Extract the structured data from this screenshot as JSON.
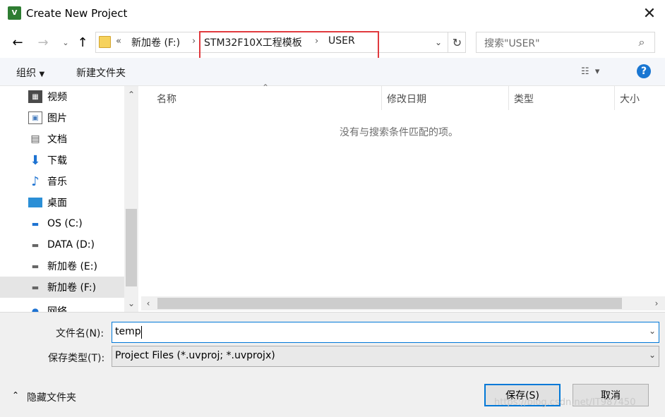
{
  "window": {
    "title": "Create New Project",
    "app_icon_text": "V"
  },
  "address": {
    "prefix_glyph": "«",
    "crumbs": [
      "新加卷 (F:)",
      "STM32F10X工程模板",
      "USER"
    ]
  },
  "search": {
    "placeholder": "搜索\"USER\""
  },
  "toolbar": {
    "organize": "组织",
    "new_folder": "新建文件夹",
    "help": "?"
  },
  "nav": {
    "items": [
      {
        "label": "视频"
      },
      {
        "label": "图片"
      },
      {
        "label": "文档"
      },
      {
        "label": "下载"
      },
      {
        "label": "音乐"
      },
      {
        "label": "桌面"
      },
      {
        "label": "OS (C:)"
      },
      {
        "label": "DATA (D:)"
      },
      {
        "label": "新加卷 (E:)"
      },
      {
        "label": "新加卷 (F:)",
        "selected": true
      },
      {
        "label": "网络"
      }
    ]
  },
  "list": {
    "columns": [
      "名称",
      "修改日期",
      "类型",
      "大小"
    ],
    "empty_message": "没有与搜索条件匹配的项。"
  },
  "form": {
    "filename_label": "文件名(N):",
    "filename_value": "temp",
    "filetype_label": "保存类型(T):",
    "filetype_value": "Project Files (*.uvproj; *.uvprojx)"
  },
  "footer": {
    "hide_folders": "隐藏文件夹",
    "save": "保存(S)",
    "cancel": "取消"
  },
  "watermark": "https://blog.csdn.net/IT987450"
}
